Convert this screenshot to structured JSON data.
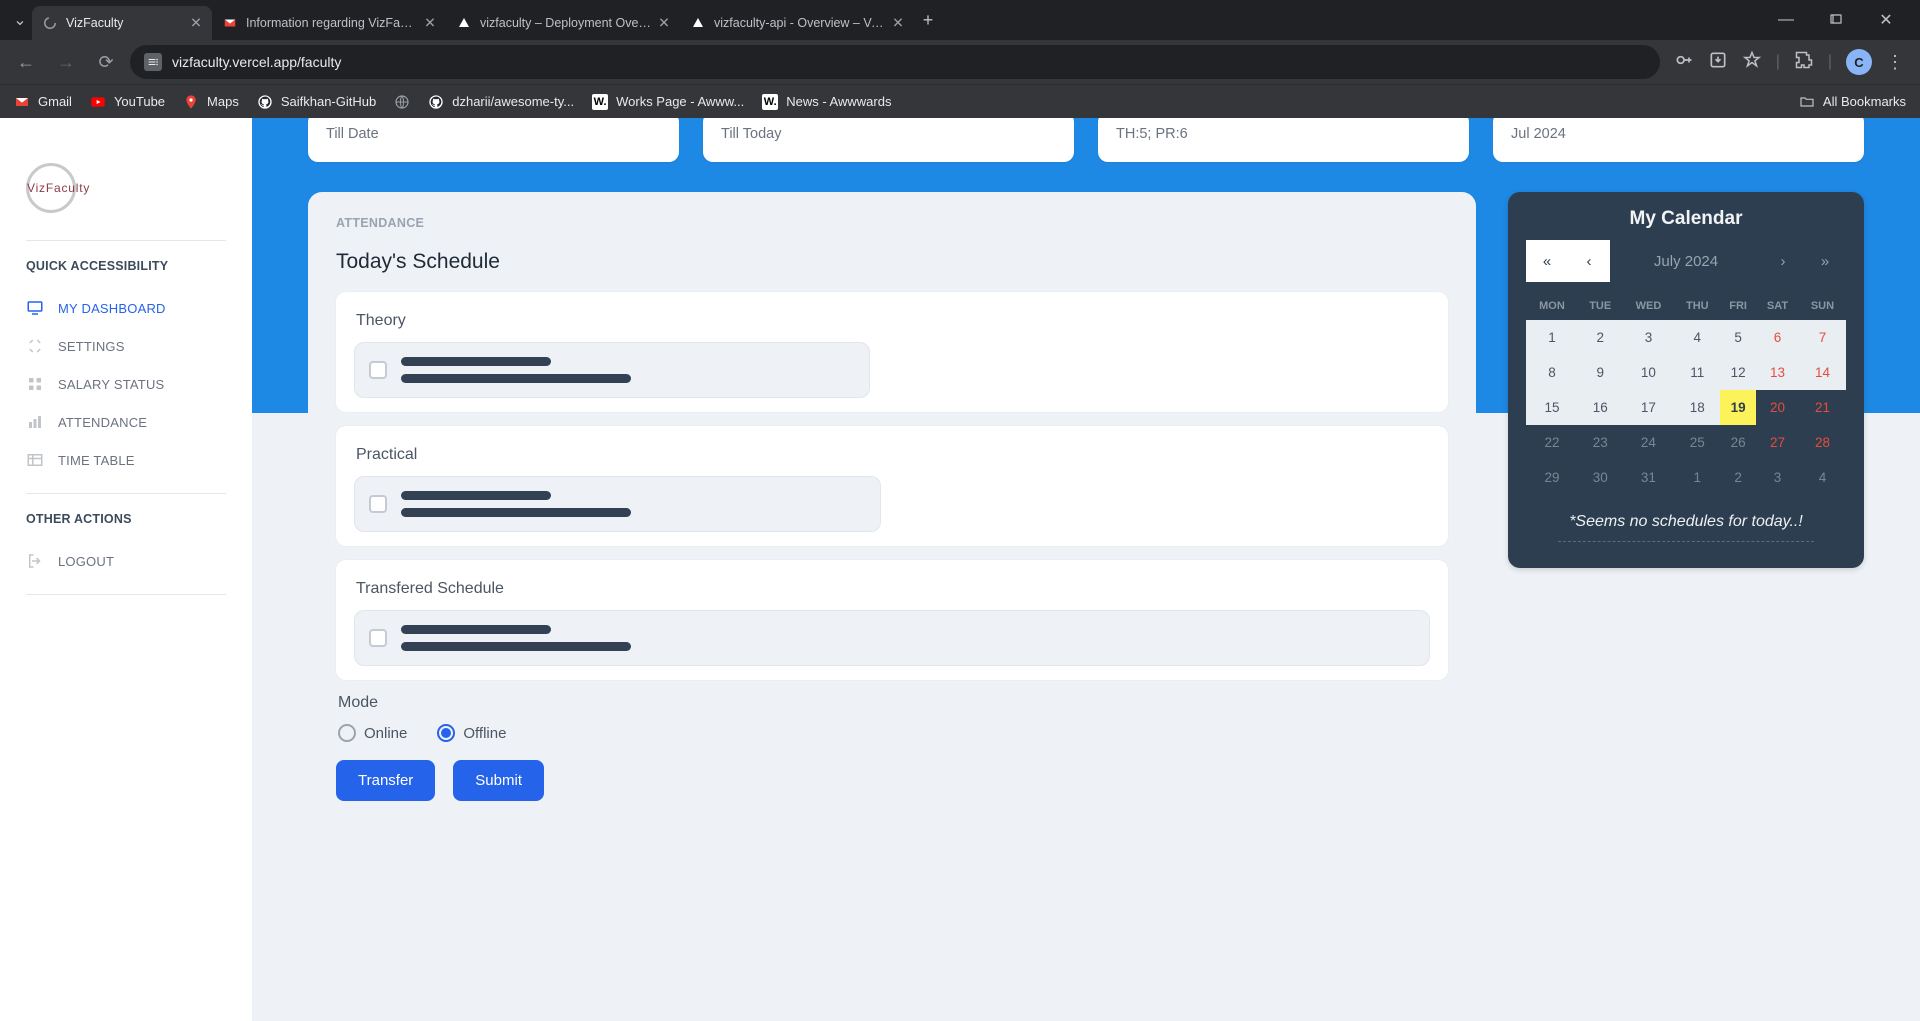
{
  "browser": {
    "tabs": [
      {
        "title": "VizFaculty",
        "icon": "spinner"
      },
      {
        "title": "Information regarding VizFaculty",
        "icon": "gmail"
      },
      {
        "title": "vizfaculty – Deployment Overview",
        "icon": "vercel"
      },
      {
        "title": "vizfaculty-api - Overview – Vercel",
        "icon": "vercel"
      }
    ],
    "url": "vizfaculty.vercel.app/faculty",
    "profile_initial": "C"
  },
  "bookmarks": [
    {
      "label": "Gmail",
      "icon": "gmail"
    },
    {
      "label": "YouTube",
      "icon": "youtube"
    },
    {
      "label": "Maps",
      "icon": "maps"
    },
    {
      "label": "Saifkhan-GitHub",
      "icon": "github"
    },
    {
      "label": "",
      "icon": "globe"
    },
    {
      "label": "dzharii/awesome-ty...",
      "icon": "github"
    },
    {
      "label": "Works Page - Awww...",
      "icon": "w"
    },
    {
      "label": "News - Awwwards",
      "icon": "w"
    }
  ],
  "bookmarks_all": "All Bookmarks",
  "sidebar": {
    "logo_text": "VizFaculty",
    "section1": "QUICK ACCESSIBILITY",
    "items1": [
      {
        "label": "MY DASHBOARD",
        "icon": "monitor",
        "active": true
      },
      {
        "label": "SETTINGS",
        "icon": "settings"
      },
      {
        "label": "SALARY STATUS",
        "icon": "grid"
      },
      {
        "label": "ATTENDANCE",
        "icon": "chart"
      },
      {
        "label": "TIME TABLE",
        "icon": "table"
      }
    ],
    "section2": "OTHER ACTIONS",
    "items2": [
      {
        "label": "LOGOUT",
        "icon": "logout"
      }
    ]
  },
  "stats": [
    {
      "sub": "Till Date"
    },
    {
      "sub": "Till Today"
    },
    {
      "sub": "TH:5; PR:6"
    },
    {
      "sub": "Jul 2024"
    }
  ],
  "attendance": {
    "label": "ATTENDANCE",
    "title": "Today's Schedule",
    "sections": {
      "theory": "Theory",
      "practical": "Practical",
      "transferred": "Transfered Schedule"
    },
    "mode_label": "Mode",
    "mode_online": "Online",
    "mode_offline": "Offline",
    "btn_transfer": "Transfer",
    "btn_submit": "Submit"
  },
  "calendar": {
    "title": "My Calendar",
    "month": "July 2024",
    "nav": {
      "first": "«",
      "prev": "‹",
      "next": "›",
      "last": "»"
    },
    "dow": [
      "MON",
      "TUE",
      "WED",
      "THU",
      "FRI",
      "SAT",
      "SUN"
    ],
    "weeks": [
      [
        {
          "d": "1"
        },
        {
          "d": "2"
        },
        {
          "d": "3"
        },
        {
          "d": "4"
        },
        {
          "d": "5"
        },
        {
          "d": "6",
          "we": true
        },
        {
          "d": "7",
          "we": true
        }
      ],
      [
        {
          "d": "8"
        },
        {
          "d": "9"
        },
        {
          "d": "10"
        },
        {
          "d": "11"
        },
        {
          "d": "12"
        },
        {
          "d": "13",
          "we": true
        },
        {
          "d": "14",
          "we": true
        }
      ],
      [
        {
          "d": "15"
        },
        {
          "d": "16"
        },
        {
          "d": "17"
        },
        {
          "d": "18"
        },
        {
          "d": "19",
          "today": true
        },
        {
          "d": "20",
          "we": true,
          "out": true
        },
        {
          "d": "21",
          "we": true,
          "out": true
        }
      ],
      [
        {
          "d": "22",
          "out": true
        },
        {
          "d": "23",
          "out": true
        },
        {
          "d": "24",
          "out": true
        },
        {
          "d": "25",
          "out": true
        },
        {
          "d": "26",
          "out": true
        },
        {
          "d": "27",
          "we": true,
          "out": true
        },
        {
          "d": "28",
          "we": true,
          "out": true
        }
      ],
      [
        {
          "d": "29",
          "out": true
        },
        {
          "d": "30",
          "out": true
        },
        {
          "d": "31",
          "out": true
        },
        {
          "d": "1",
          "out": true
        },
        {
          "d": "2",
          "out": true
        },
        {
          "d": "3",
          "out": true
        },
        {
          "d": "4",
          "out": true
        }
      ]
    ],
    "message": "*Seems no schedules for today..!"
  }
}
